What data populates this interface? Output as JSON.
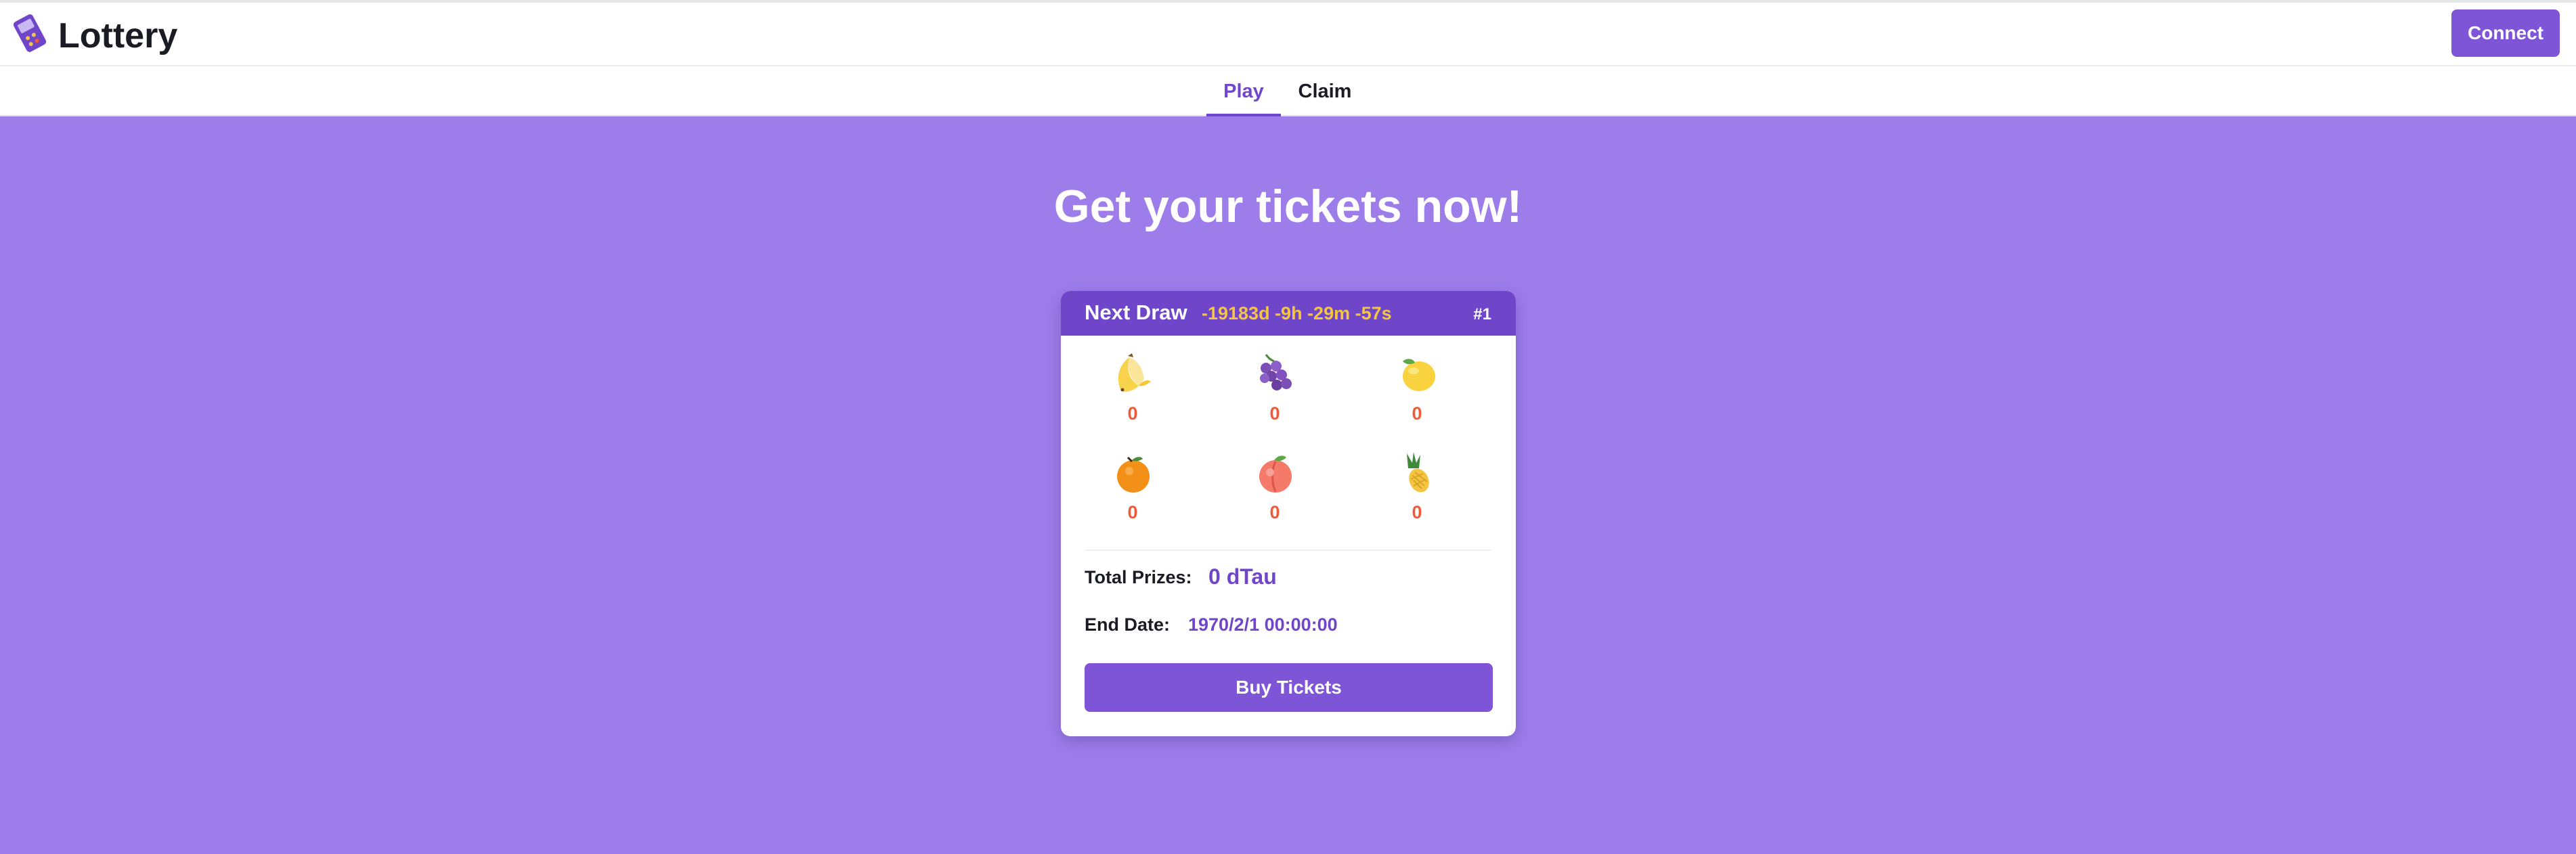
{
  "header": {
    "brand": "Lottery",
    "connect_label": "Connect"
  },
  "tabs": [
    {
      "label": "Play",
      "active": true
    },
    {
      "label": "Claim",
      "active": false
    }
  ],
  "hero": {
    "title": "Get your tickets now!"
  },
  "draw": {
    "label": "Next Draw",
    "countdown": "-19183d -9h -29m -57s",
    "number": "#1",
    "fruits": [
      {
        "icon": "banana-icon",
        "count": "0"
      },
      {
        "icon": "grapes-icon",
        "count": "0"
      },
      {
        "icon": "lemon-icon",
        "count": "0"
      },
      {
        "icon": "orange-icon",
        "count": "0"
      },
      {
        "icon": "peach-icon",
        "count": "0"
      },
      {
        "icon": "pineapple-icon",
        "count": "0"
      }
    ],
    "total_prizes_label": "Total Prizes:",
    "total_prizes_value": "0 dTau",
    "end_date_label": "End Date:",
    "end_date_value": "1970/2/1 00:00:00",
    "buy_label": "Buy Tickets"
  },
  "colors": {
    "accent": "#7d55d6",
    "background": "#9d7dea",
    "countdown": "#f5c542",
    "count": "#ef5a3a"
  }
}
